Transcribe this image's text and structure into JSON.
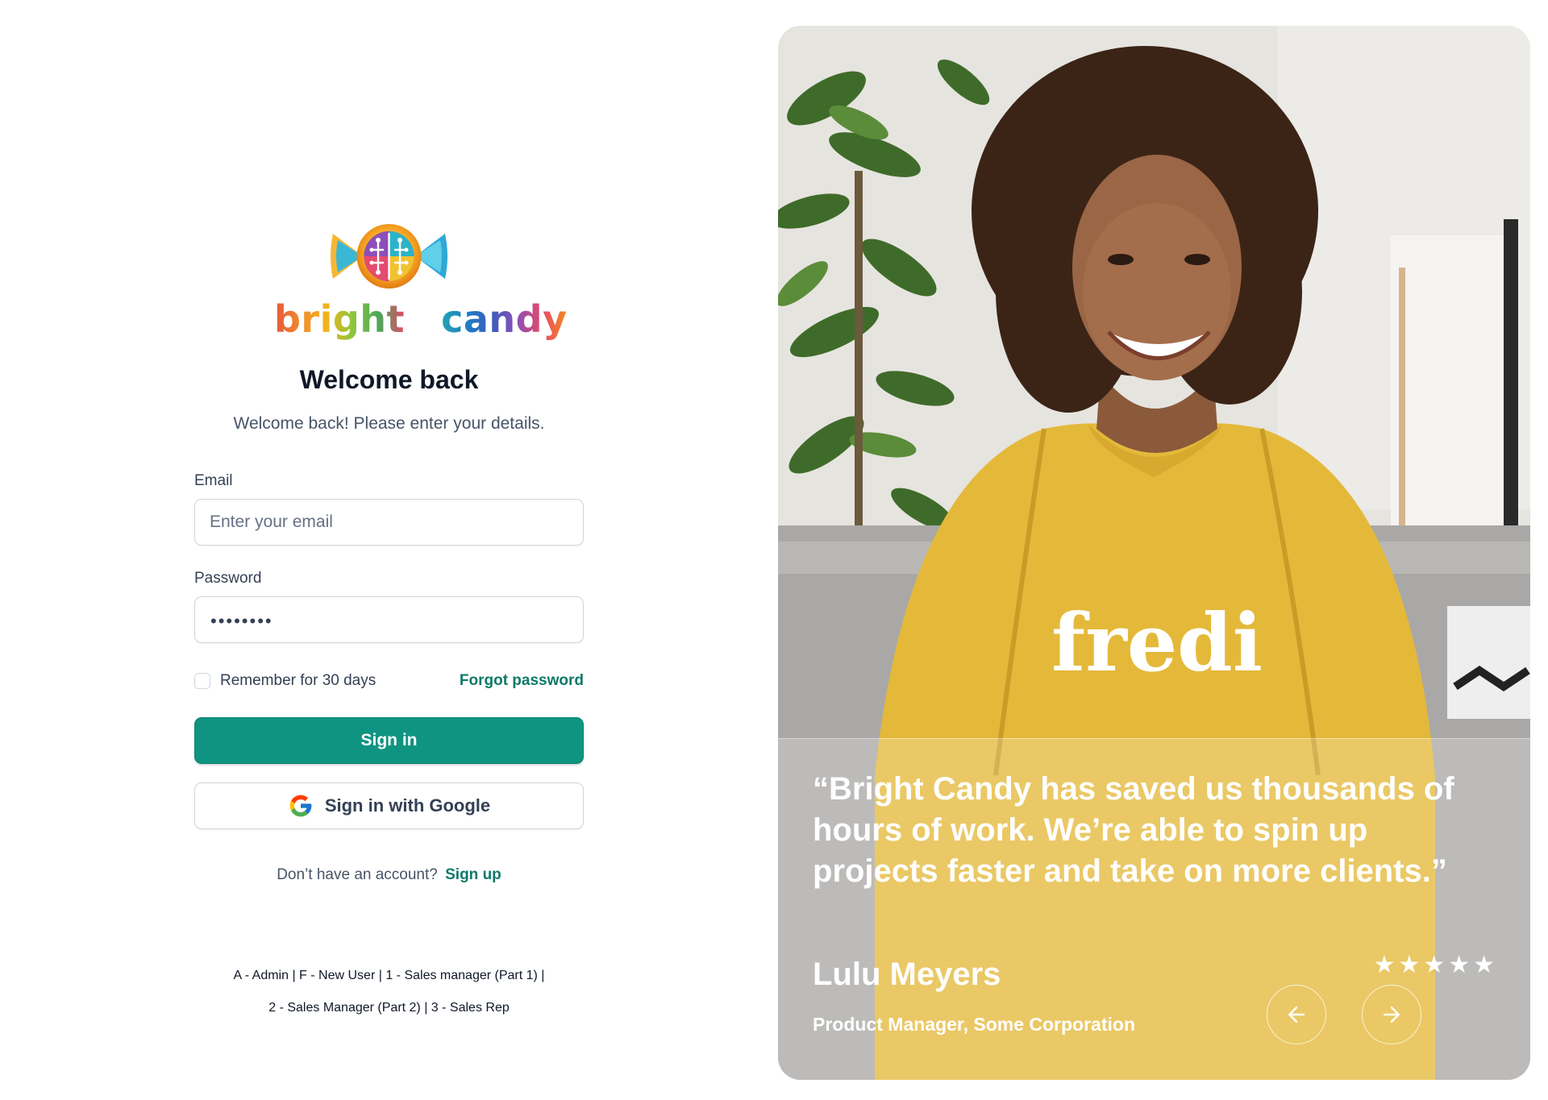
{
  "brand": {
    "name_part1": "bright",
    "name_part2": "candy",
    "logo_icon": "candy-icon",
    "colors": {
      "b": "#e8553b",
      "r": "#f08a2c",
      "i": "#f5b21c",
      "g": "#8cc63f",
      "h": "#49a95a",
      "t": "#e84868",
      "c": "#22a5b5",
      "a": "#1e7fc2",
      "n": "#3b5bbd",
      "d": "#8c4fb8",
      "y": "#f28c1c"
    }
  },
  "login": {
    "title": "Welcome back",
    "subtitle": "Welcome back! Please enter your details.",
    "email_label": "Email",
    "email_placeholder": "Enter your email",
    "email_value": "",
    "password_label": "Password",
    "password_value": "••••••••",
    "remember_label": "Remember for 30 days",
    "remember_checked": false,
    "forgot_label": "Forgot password",
    "sign_in_label": "Sign in",
    "google_label": "Sign in with Google",
    "no_account_text": "Don’t have an account?",
    "sign_up_label": "Sign up",
    "shortcuts_line1": "A - Admin | F - New User | 1 - Sales manager (Part 1) |",
    "shortcuts_line2": "2 - Sales Manager (Part 2) | 3 - Sales Rep"
  },
  "testimonial": {
    "quote": "“Bright Candy has saved us thousands of hours of work. We’re able to spin up projects faster and take on more clients.”",
    "author": "Lulu Meyers",
    "role": "Product Manager, Some Corporation",
    "rating": 5,
    "stars": "★★★★★",
    "sweater_text": "fredi",
    "prev_icon": "arrow-left-icon",
    "next_icon": "arrow-right-icon"
  },
  "colors": {
    "primary": "#109482",
    "link": "#0c7a68",
    "sweater": "#e4b93a"
  }
}
